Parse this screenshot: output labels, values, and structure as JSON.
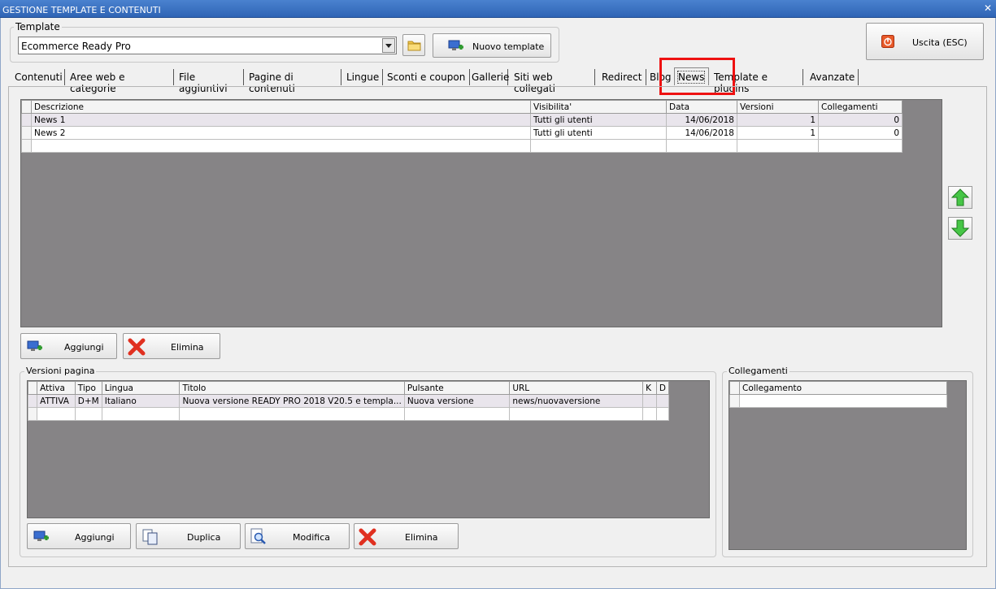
{
  "window": {
    "title": "GESTIONE TEMPLATE E CONTENUTI",
    "close_glyph": "✕"
  },
  "template_group": {
    "legend": "Template",
    "selected_value": "Ecommerce Ready Pro",
    "new_template_label": "Nuovo template"
  },
  "exit_button": {
    "label": "Uscita (ESC)"
  },
  "tabs": [
    {
      "label": "Contenuti"
    },
    {
      "label": "Aree web e categorie"
    },
    {
      "label": "File aggiuntivi"
    },
    {
      "label": "Pagine di contenuti"
    },
    {
      "label": "Lingue"
    },
    {
      "label": "Sconti e coupon"
    },
    {
      "label": "Gallerie"
    },
    {
      "label": "Siti web collegati"
    },
    {
      "label": "Redirect"
    },
    {
      "label": "Blog"
    },
    {
      "label": "News"
    },
    {
      "label": "Template e plugins"
    },
    {
      "label": "Avanzate"
    }
  ],
  "active_tab": "News",
  "news_grid": {
    "headers": [
      "Descrizione",
      "Visibilita'",
      "Data",
      "Versioni",
      "Collegamenti"
    ],
    "rows": [
      [
        "News 1",
        "Tutti gli utenti",
        "14/06/2018",
        "1",
        "0"
      ],
      [
        "News 2",
        "Tutti gli utenti",
        "14/06/2018",
        "1",
        "0"
      ]
    ]
  },
  "news_buttons": {
    "add": "Aggiungi",
    "delete": "Elimina"
  },
  "versions_group": {
    "legend": "Versioni pagina",
    "headers": [
      "Attiva",
      "Tipo",
      "Lingua",
      "Titolo",
      "Pulsante",
      "URL",
      "K",
      "D"
    ],
    "rows": [
      [
        "ATTIVA",
        "D+M",
        "Italiano",
        "Nuova versione READY PRO 2018 V20.5 e templa...",
        "Nuova versione",
        "news/nuovaversione",
        "",
        ""
      ]
    ],
    "buttons": {
      "add": "Aggiungi",
      "duplicate": "Duplica",
      "edit": "Modifica",
      "delete": "Elimina"
    }
  },
  "links_group": {
    "legend": "Collegamenti",
    "headers": [
      "Collegamento"
    ]
  },
  "colors": {
    "highlight": "#ee1111",
    "titlebar": "#3a70c0",
    "grid_bg": "#868486"
  },
  "icons": {
    "folder": "folder-icon",
    "new_template": "monitor-plus-icon",
    "exit": "power-icon",
    "up": "arrow-up-icon",
    "down": "arrow-down-icon",
    "add": "monitor-plus-icon",
    "delete": "red-x-icon",
    "duplicate": "copy-icon",
    "edit": "magnifier-doc-icon"
  }
}
